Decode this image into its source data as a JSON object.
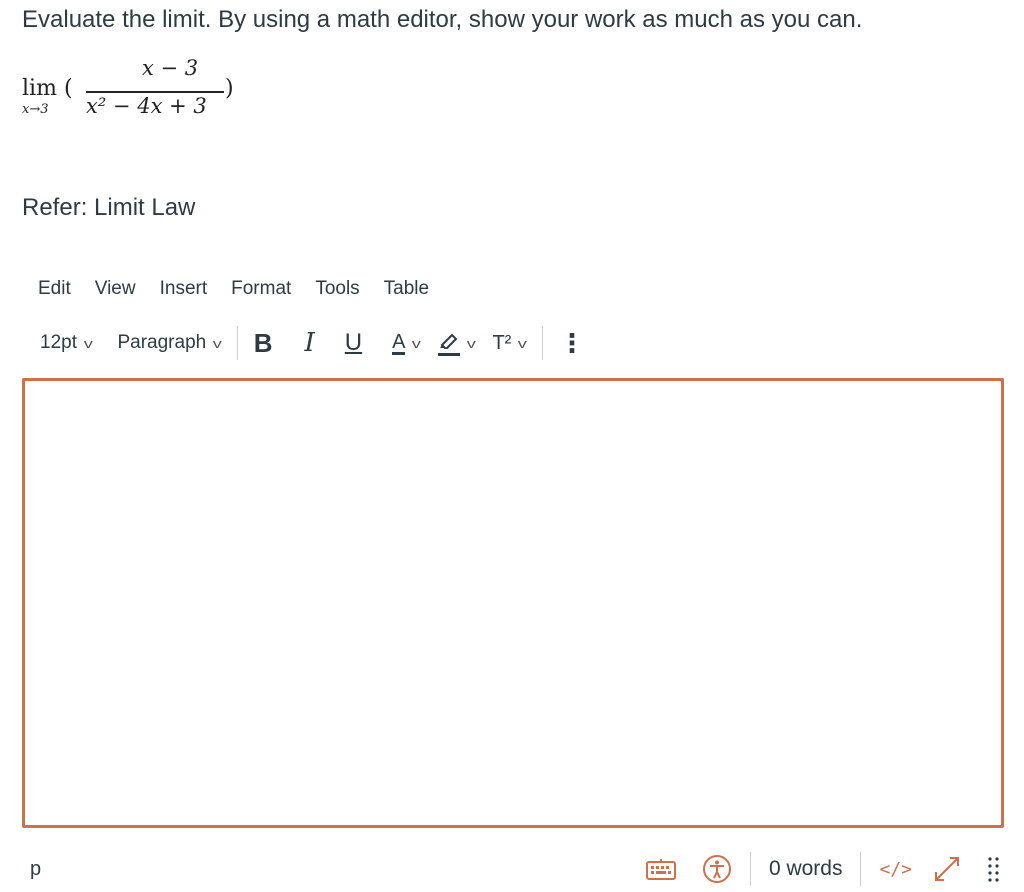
{
  "question": {
    "prompt": "Evaluate the limit. By using a math editor, show your work as much as you can.",
    "math": {
      "lim": "lim",
      "subscript": "x→3",
      "open_paren": "(",
      "close_paren": ")",
      "numerator": "x − 3",
      "denominator": "x² − 4x + 3"
    },
    "refer": "Refer: Limit Law"
  },
  "editor": {
    "menu": [
      "Edit",
      "View",
      "Insert",
      "Format",
      "Tools",
      "Table"
    ],
    "toolbar": {
      "font_size": "12pt",
      "block_format": "Paragraph",
      "bold": "B",
      "italic": "I",
      "underline": "U",
      "font_color": "A",
      "superscript": "T²",
      "more": "⋮"
    },
    "body_text": "",
    "status": {
      "path": "p",
      "word_count": "0 words",
      "html_toggle": "</>",
      "border_color": "#d0704a"
    }
  }
}
